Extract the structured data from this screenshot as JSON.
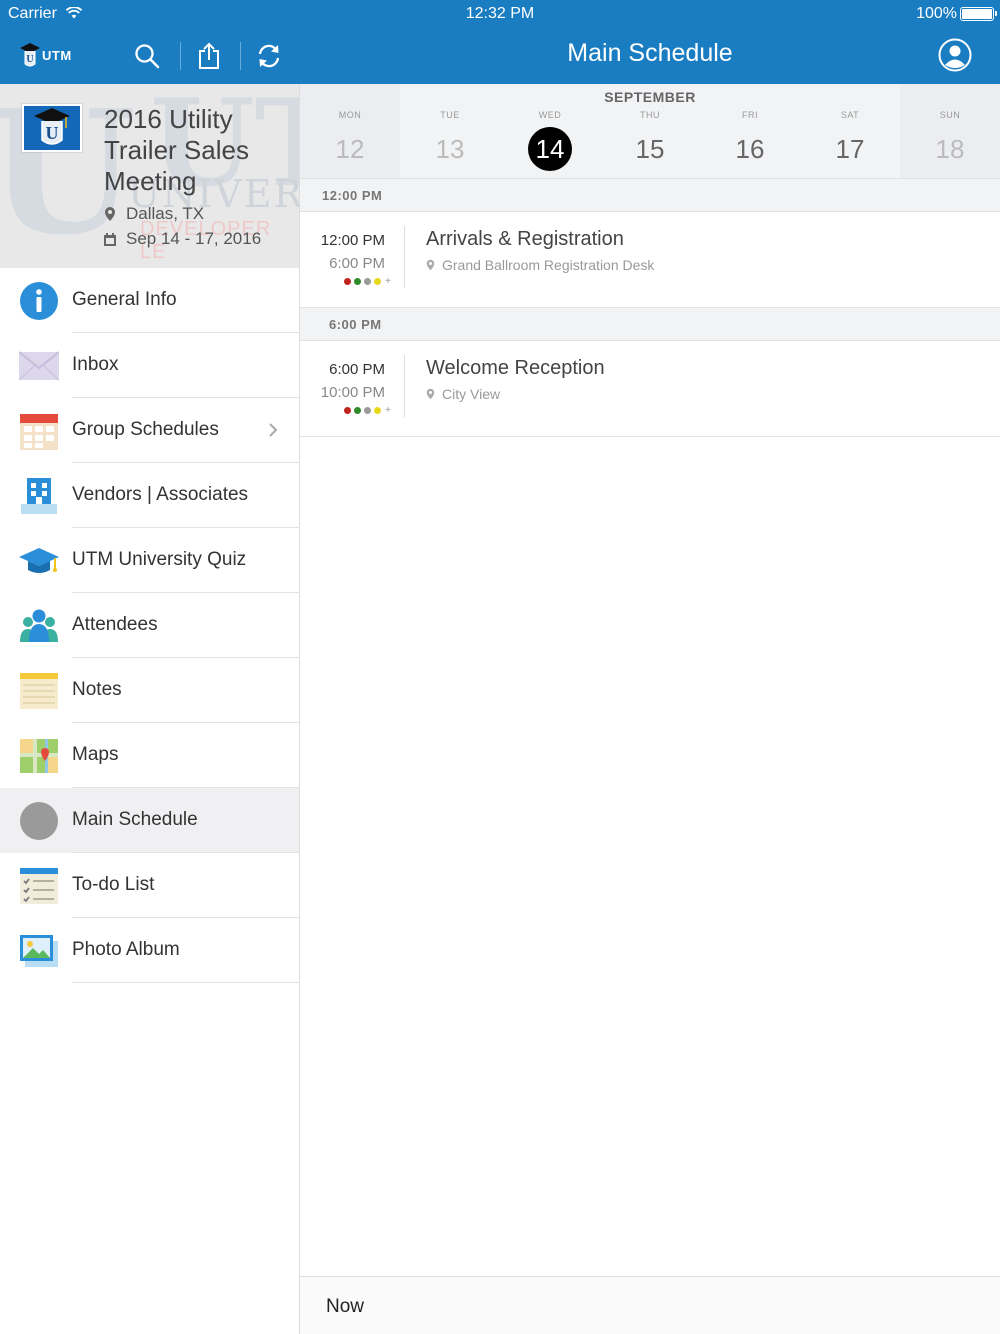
{
  "status_bar": {
    "carrier": "Carrier",
    "time": "12:32 PM",
    "battery": "100%"
  },
  "header": {
    "logo_text": "UTM",
    "title": "Main Schedule",
    "icons": [
      "search-icon",
      "share-icon",
      "refresh-icon",
      "profile-icon"
    ]
  },
  "event": {
    "title": "2016 Utility Trailer Sales Meeting",
    "location": "Dallas, TX",
    "dates": "Sep 14 - 17, 2016",
    "bg_text": "UTI",
    "bg_univ": "UNIVERS",
    "bg_dev": "DEVELOPER LE"
  },
  "menu": {
    "items": [
      {
        "label": "General Info",
        "icon": "info-icon"
      },
      {
        "label": "Inbox",
        "icon": "envelope-icon"
      },
      {
        "label": "Group Schedules",
        "icon": "calendar-icon",
        "has_chevron": true
      },
      {
        "label": "Vendors | Associates",
        "icon": "building-icon"
      },
      {
        "label": "UTM University Quiz",
        "icon": "graduation-cap-icon"
      },
      {
        "label": "Attendees",
        "icon": "people-icon"
      },
      {
        "label": "Notes",
        "icon": "notepad-icon"
      },
      {
        "label": "Maps",
        "icon": "map-icon"
      },
      {
        "label": "Main Schedule",
        "icon": "circle-icon",
        "active": true
      },
      {
        "label": "To-do List",
        "icon": "checklist-icon"
      },
      {
        "label": "Photo Album",
        "icon": "photo-icon"
      }
    ]
  },
  "calendar": {
    "month": "SEPTEMBER",
    "days": [
      {
        "name": "MON",
        "num": "12"
      },
      {
        "name": "TUE",
        "num": "13"
      },
      {
        "name": "WED",
        "num": "14",
        "selected": true
      },
      {
        "name": "THU",
        "num": "15"
      },
      {
        "name": "FRI",
        "num": "16"
      },
      {
        "name": "SAT",
        "num": "17"
      },
      {
        "name": "SUN",
        "num": "18"
      }
    ]
  },
  "schedule": [
    {
      "header": "12:00 PM",
      "start": "12:00 PM",
      "end": "6:00 PM",
      "title": "Arrivals & Registration",
      "location": "Grand Ballroom Registration Desk"
    },
    {
      "header": "6:00 PM",
      "start": "6:00 PM",
      "end": "10:00 PM",
      "title": "Welcome Reception",
      "location": "City View"
    }
  ],
  "tag_colors": [
    "#c0241c",
    "#2e8a2a",
    "#9a9a9a",
    "#e8d81c"
  ],
  "tag_more": "+",
  "colors": {
    "brand_blue": "#1a7dc2",
    "selected_day": "#000000"
  },
  "footer": {
    "now_label": "Now"
  }
}
